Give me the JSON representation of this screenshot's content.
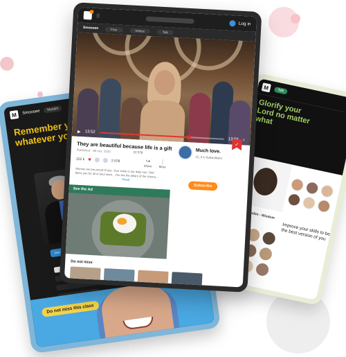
{
  "center": {
    "login_label": "Log in",
    "brand": "Smoosee",
    "tabs": [
      "Free",
      "Videos",
      "Talk"
    ],
    "video": {
      "time_current": "13:52",
      "time_total": "13:56",
      "progress": 0.72,
      "title": "They are beautiful because  life is a gift",
      "published": "Published : 08 nov. 2020",
      "views": "22 578",
      "likes": "122 k",
      "dislikes": "2 078",
      "share_label": "Share",
      "more_label": "More",
      "description": "Women we are proud of you. Your smile is our daily sun. God bless you for all of your work... You are the pillars of the Umma...",
      "read_more": "Read"
    },
    "channel": {
      "name": "Much love.",
      "subscribers": "12_4 k Subscribers",
      "subscribe_label": "Subscribe"
    },
    "ad_label": "See the Ad",
    "section_title": "Do not miss"
  },
  "left": {
    "brand": "Smoosee",
    "pill": "Muslim",
    "title": "Remember your Lord whatever you do",
    "cta_label": "Get started",
    "banner_label": "Do not miss this class"
  },
  "right": {
    "pill": "Talk",
    "title": "Glorify your Lord no matter what",
    "caption_left": "Just 4 Muslim - Wisdom of the day",
    "caption_right": "Improve your skills to be the best version of you"
  },
  "colors": {
    "accent_orange": "#ff8c1a",
    "accent_red": "#e0322f",
    "left_title_yellow": "#f0c419",
    "right_title_green": "#a5d06a",
    "link_blue": "#2e8bd6"
  }
}
